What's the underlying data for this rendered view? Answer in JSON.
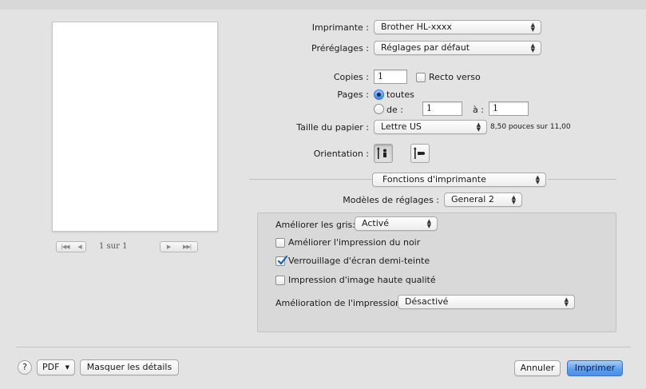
{
  "preview": {
    "page_indicator": "1 sur 1",
    "nav": {
      "first": "|◀◀",
      "prev": "◀",
      "next": "▶",
      "last": "▶▶|"
    }
  },
  "printer": {
    "label": "Imprimante :",
    "value": "Brother HL-xxxx"
  },
  "presets": {
    "label": "Préréglages :",
    "value": "Réglages par défaut"
  },
  "copies": {
    "label": "Copies :",
    "value": "1",
    "duplex_label": "Recto verso",
    "duplex_checked": false
  },
  "pages": {
    "label": "Pages :",
    "all_label": "toutes",
    "from_label": "de :",
    "from_value": "1",
    "to_label": "à :",
    "to_value": "1",
    "selected": "all"
  },
  "paper_size": {
    "label": "Taille du papier :",
    "value": "Lettre US",
    "dimensions": "8,50 pouces sur 11,00"
  },
  "orientation": {
    "label": "Orientation :",
    "selected": "portrait"
  },
  "section": {
    "value": "Fonctions d'imprimante"
  },
  "feature_sets": {
    "label": "Modèles de réglages :",
    "value": "General 2"
  },
  "options": {
    "improve_gray": {
      "label": "Améliorer les gris:",
      "value": "Activé"
    },
    "improve_black": {
      "label": "Améliorer l'impression du noir",
      "checked": false
    },
    "halftone_lock": {
      "label": "Verrouillage d'écran demi-teinte",
      "checked": true
    },
    "high_quality_image": {
      "label": "Impression d'image haute qualité",
      "checked": false
    },
    "print_improvement": {
      "label": "Amélioration de l'impression:",
      "value": "Désactivé"
    }
  },
  "footer": {
    "help": "?",
    "pdf": "PDF",
    "hide_details": "Masquer les détails",
    "cancel": "Annuler",
    "print": "Imprimer"
  },
  "colors": {
    "accent": "#4c8fe6",
    "check": "#1f5fbf"
  }
}
